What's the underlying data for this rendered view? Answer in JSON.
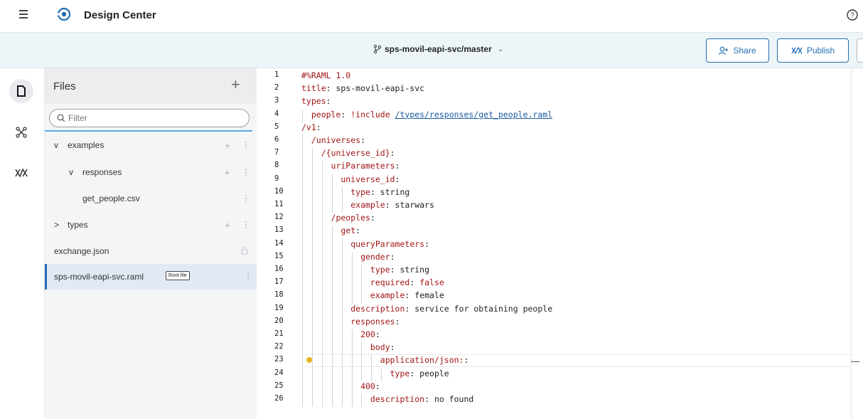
{
  "header": {
    "app_title": "Design Center",
    "menu_icon": "hamburger-menu-icon",
    "logo_icon": "design-center-logo-icon",
    "help_icon": "help-circle-icon"
  },
  "branchbar": {
    "branch_label": "sps-movil-eapi-svc/master",
    "share_label": "Share",
    "publish_label": "Publish"
  },
  "rail": {
    "items": [
      "files-icon",
      "api-graph-icon",
      "exchange-icon"
    ]
  },
  "files": {
    "title": "Files",
    "filter_placeholder": "Filter",
    "tree": [
      {
        "label": "examples",
        "expander": "v",
        "depth": 0
      },
      {
        "label": "responses",
        "expander": "v",
        "depth": 1
      },
      {
        "label": "get_people.csv",
        "expander": "",
        "depth": 2
      },
      {
        "label": "types",
        "expander": ">",
        "depth": 0
      },
      {
        "label": "exchange.json",
        "expander": "",
        "depth": 0
      },
      {
        "label": "sps-movil-eapi-svc.raml",
        "expander": "",
        "depth": 0,
        "badge": "Root file",
        "selected": true
      }
    ]
  },
  "editor": {
    "lines": [
      {
        "n": "1",
        "parts": [
          [
            "k",
            "#%RAML 1.0"
          ]
        ]
      },
      {
        "n": "2",
        "parts": [
          [
            "k",
            "title"
          ],
          [
            "txt",
            ": sps-movil-eapi-svc"
          ]
        ]
      },
      {
        "n": "3",
        "parts": [
          [
            "k",
            "types"
          ],
          [
            "txt",
            ":"
          ]
        ]
      },
      {
        "n": "4",
        "parts": [
          [
            "k",
            "  people"
          ],
          [
            "txt",
            ": "
          ],
          [
            "k",
            "!include "
          ],
          [
            "ul",
            "/types/responses/get_people.raml"
          ]
        ]
      },
      {
        "n": "5",
        "parts": [
          [
            "k",
            "/v1"
          ],
          [
            "txt",
            ":"
          ]
        ]
      },
      {
        "n": "6",
        "parts": [
          [
            "k",
            "  /universes"
          ],
          [
            "txt",
            ":"
          ]
        ]
      },
      {
        "n": "7",
        "parts": [
          [
            "k",
            "    /{universe_id}"
          ],
          [
            "txt",
            ":"
          ]
        ]
      },
      {
        "n": "8",
        "parts": [
          [
            "k",
            "      uriParameters"
          ],
          [
            "txt",
            ":"
          ]
        ]
      },
      {
        "n": "9",
        "parts": [
          [
            "k",
            "        universe_id"
          ],
          [
            "txt",
            ":"
          ]
        ]
      },
      {
        "n": "10",
        "parts": [
          [
            "k",
            "          type"
          ],
          [
            "txt",
            ": string"
          ]
        ]
      },
      {
        "n": "11",
        "parts": [
          [
            "k",
            "          example"
          ],
          [
            "txt",
            ": starwars"
          ]
        ]
      },
      {
        "n": "12",
        "parts": [
          [
            "k",
            "      /peoples"
          ],
          [
            "txt",
            ":"
          ]
        ]
      },
      {
        "n": "13",
        "parts": [
          [
            "k",
            "        get"
          ],
          [
            "txt",
            ":"
          ]
        ]
      },
      {
        "n": "14",
        "parts": [
          [
            "k",
            "          queryParameters"
          ],
          [
            "txt",
            ":"
          ]
        ]
      },
      {
        "n": "15",
        "parts": [
          [
            "k",
            "            gender"
          ],
          [
            "txt",
            ":"
          ]
        ]
      },
      {
        "n": "16",
        "parts": [
          [
            "k",
            "              type"
          ],
          [
            "txt",
            ": string"
          ]
        ]
      },
      {
        "n": "17",
        "parts": [
          [
            "k",
            "              required"
          ],
          [
            "txt",
            ": "
          ],
          [
            "k",
            "false"
          ]
        ]
      },
      {
        "n": "18",
        "parts": [
          [
            "k",
            "              example"
          ],
          [
            "txt",
            ": female"
          ]
        ]
      },
      {
        "n": "19",
        "parts": [
          [
            "k",
            "          description"
          ],
          [
            "txt",
            ": service for obtaining people"
          ]
        ]
      },
      {
        "n": "20",
        "parts": [
          [
            "k",
            "          responses"
          ],
          [
            "txt",
            ":"
          ]
        ]
      },
      {
        "n": "21",
        "parts": [
          [
            "k",
            "            200"
          ],
          [
            "txt",
            ":"
          ]
        ]
      },
      {
        "n": "22",
        "parts": [
          [
            "k",
            "              body"
          ],
          [
            "txt",
            ":"
          ]
        ]
      },
      {
        "n": "23",
        "parts": [
          [
            "k",
            "                application/json:"
          ],
          [
            "txt",
            ":"
          ]
        ]
      },
      {
        "n": "24",
        "parts": [
          [
            "k",
            "                  type"
          ],
          [
            "txt",
            ": people"
          ]
        ]
      },
      {
        "n": "25",
        "parts": [
          [
            "k",
            "            400"
          ],
          [
            "txt",
            ":"
          ]
        ]
      },
      {
        "n": "26",
        "parts": [
          [
            "k",
            "              description"
          ],
          [
            "txt",
            ": no found"
          ]
        ]
      }
    ],
    "current_line": "23"
  }
}
